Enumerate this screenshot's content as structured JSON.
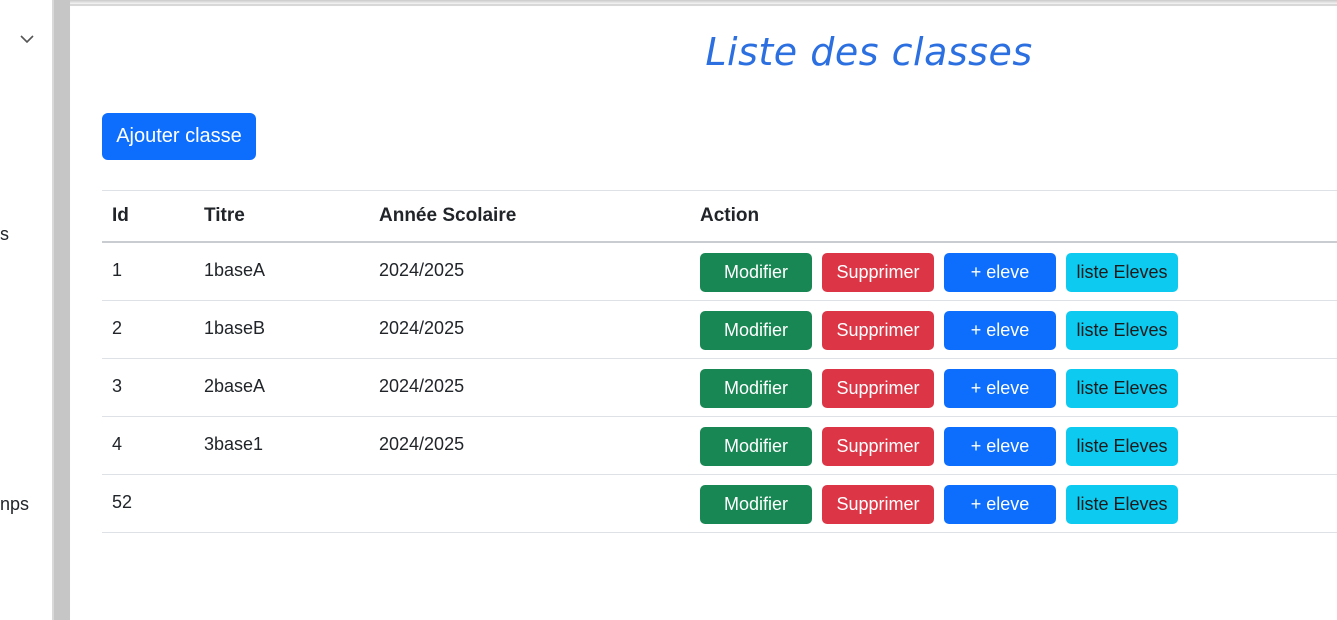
{
  "sidebar": {
    "fragments": [
      "s",
      "nps"
    ]
  },
  "page": {
    "title": "Liste des classes",
    "add_button": "Ajouter classe"
  },
  "table": {
    "headers": [
      "Id",
      "Titre",
      "Année Scolaire",
      "Action"
    ],
    "rows": [
      {
        "id": "1",
        "titre": "1baseA",
        "annee": "2024/2025"
      },
      {
        "id": "2",
        "titre": "1baseB",
        "annee": "2024/2025"
      },
      {
        "id": "3",
        "titre": "2baseA",
        "annee": "2024/2025"
      },
      {
        "id": "4",
        "titre": "3base1",
        "annee": "2024/2025"
      },
      {
        "id": "52",
        "titre": "",
        "annee": ""
      }
    ],
    "actions": {
      "modify": "Modifier",
      "delete": "Supprimer",
      "add_student": "+ eleve",
      "list_students": "liste Eleves"
    }
  },
  "colors": {
    "title": "#2b6fe0",
    "primary": "#0d6efd",
    "success": "#198754",
    "danger": "#dc3545",
    "info": "#0dcaf0"
  }
}
